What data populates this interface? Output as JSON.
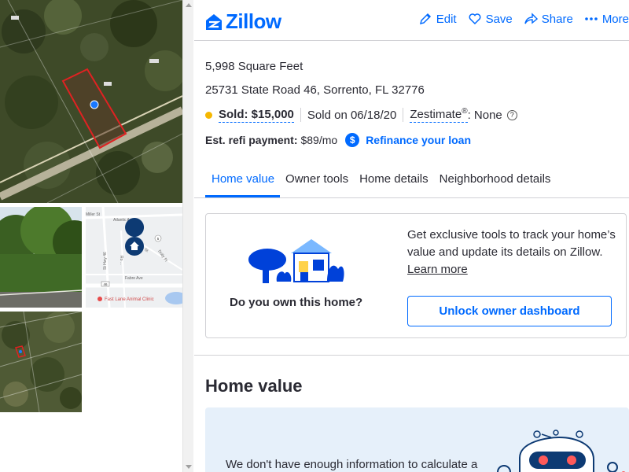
{
  "brand": {
    "name": "Zillow",
    "color": "#006aff"
  },
  "header_actions": [
    {
      "label": "Edit",
      "icon": "pencil-icon"
    },
    {
      "label": "Save",
      "icon": "heart-icon"
    },
    {
      "label": "Share",
      "icon": "share-icon"
    },
    {
      "label": "More",
      "icon": "more-dots-icon"
    }
  ],
  "photos": {
    "map": {
      "streets": [
        "Atlantic Ave",
        "Miller St",
        "Apple St",
        "Dolly Pl",
        "Fabre Ave",
        "St Hwy 46",
        "Ro ..."
      ],
      "road_badges": [
        "46",
        "5"
      ],
      "place": "Fast Lane Animal Clinic"
    }
  },
  "property": {
    "area": "5,998 Square Feet",
    "address": "25731 State Road 46, Sorrento, FL 32776",
    "status": {
      "label": "Sold:",
      "price": "$15,000",
      "sold_date": "Sold on 06/18/20",
      "zestimate_label": "Zestimate",
      "zestimate_mark": "®",
      "zestimate_value": ": None",
      "help": "?",
      "dot_color": "#f5b701"
    },
    "refi": {
      "label": "Est. refi payment:",
      "value": "$89/mo",
      "icon_symbol": "$",
      "link": "Refinance your loan"
    }
  },
  "tabs": [
    {
      "label": "Home value",
      "active": true
    },
    {
      "label": "Owner tools",
      "active": false
    },
    {
      "label": "Home details",
      "active": false
    },
    {
      "label": "Neighborhood details",
      "active": false
    }
  ],
  "owner_card": {
    "question": "Do you own this home?",
    "description": "Get exclusive tools to track your home’s value and update its details on Zillow.",
    "learn_more": "Learn more",
    "button": "Unlock owner dashboard"
  },
  "home_value": {
    "title": "Home value",
    "message": "We don't have enough information to calculate a"
  }
}
